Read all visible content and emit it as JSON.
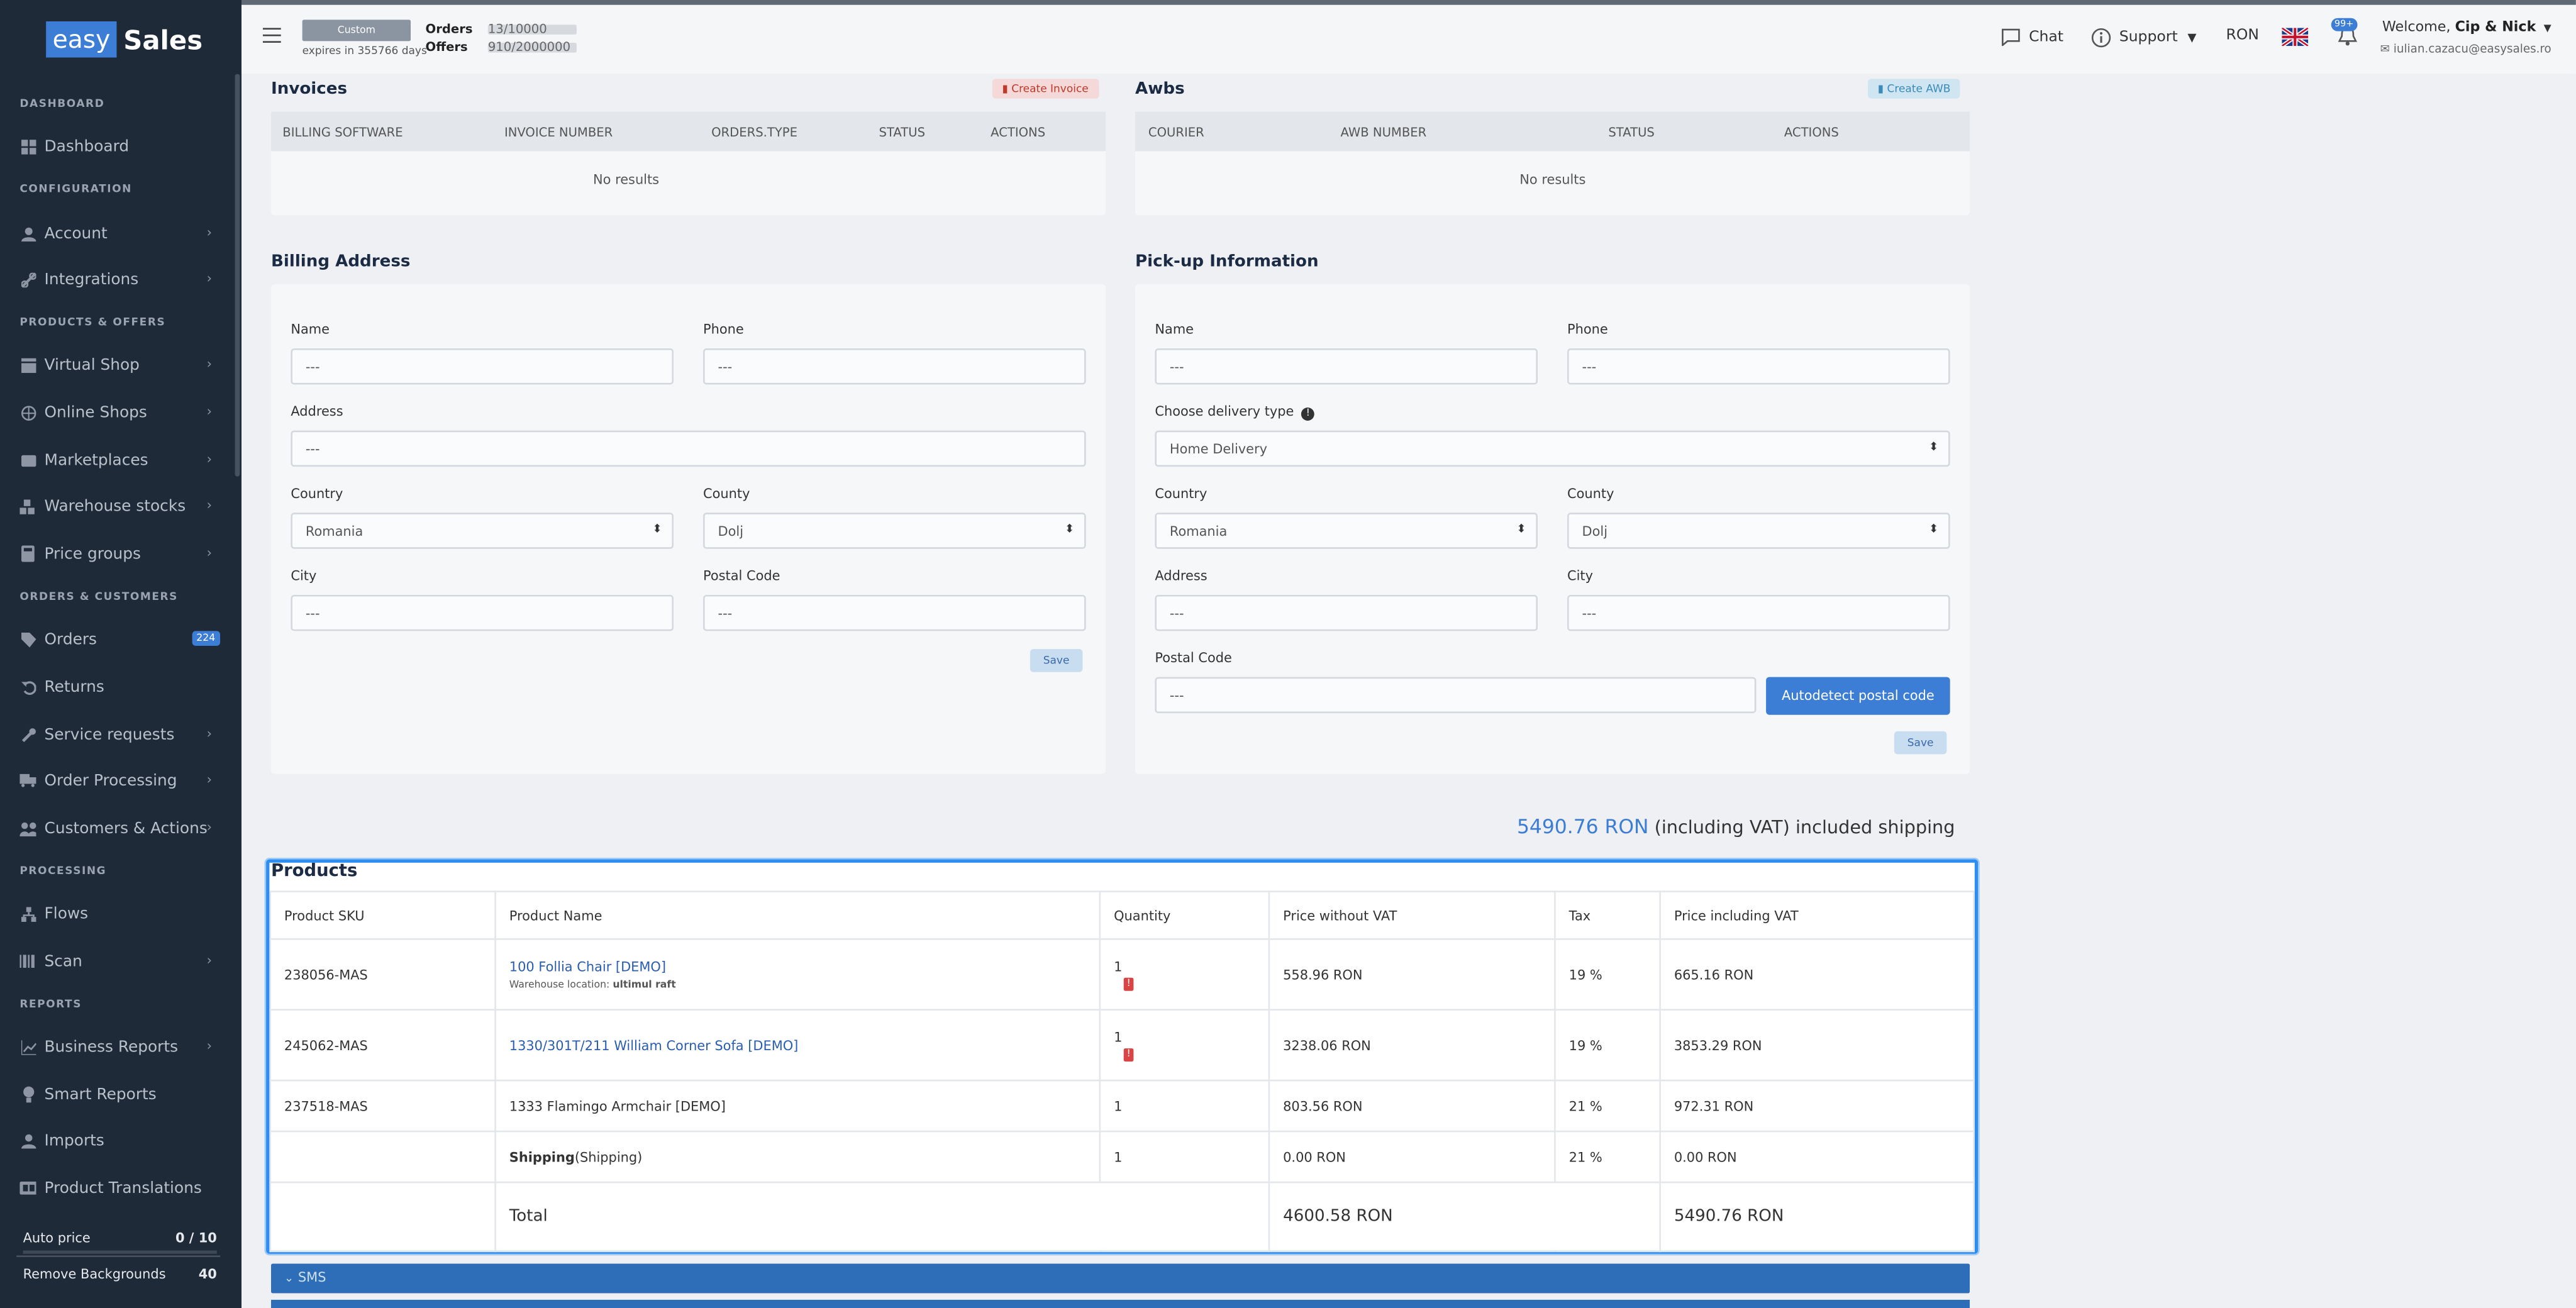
{
  "logo": {
    "left": "easy",
    "right": "Sales"
  },
  "sidebar": {
    "sections": {
      "dashboard": "DASHBOARD",
      "configuration": "CONFIGURATION",
      "products": "PRODUCTS & OFFERS",
      "orders": "ORDERS & CUSTOMERS",
      "processing": "PROCESSING",
      "reports": "REPORTS"
    },
    "items": [
      {
        "label": "Dashboard",
        "icon": "dashboard-icon"
      },
      {
        "label": "Account",
        "icon": "user-icon"
      },
      {
        "label": "Integrations",
        "icon": "link-icon"
      },
      {
        "label": "Virtual Shop",
        "icon": "store-icon"
      },
      {
        "label": "Online Shops",
        "icon": "globe-icon"
      },
      {
        "label": "Marketplaces",
        "icon": "marketplace-icon"
      },
      {
        "label": "Warehouse stocks",
        "icon": "boxes-icon"
      },
      {
        "label": "Price groups",
        "icon": "calculator-icon"
      },
      {
        "label": "Orders",
        "icon": "tag-icon",
        "badge": "224"
      },
      {
        "label": "Returns",
        "icon": "undo-icon"
      },
      {
        "label": "Service requests",
        "icon": "wrench-icon"
      },
      {
        "label": "Order Processing",
        "icon": "truck-icon"
      },
      {
        "label": "Customers & Actions",
        "icon": "users-icon"
      },
      {
        "label": "Flows",
        "icon": "flows-icon"
      },
      {
        "label": "Scan",
        "icon": "barcode-icon"
      },
      {
        "label": "Business Reports",
        "icon": "chart-icon"
      },
      {
        "label": "Smart Reports",
        "icon": "bulb-icon"
      },
      {
        "label": "Imports",
        "icon": "import-icon"
      },
      {
        "label": "Product Translations",
        "icon": "translate-icon"
      }
    ],
    "credits": [
      {
        "label": "Auto price",
        "value": "0 / 10"
      },
      {
        "label": "Remove Backgrounds",
        "value": "40"
      }
    ]
  },
  "header": {
    "plan": "Custom",
    "expires": "expires in 355766 days",
    "orders_label": "Orders",
    "orders_value": "13/10000",
    "offers_label": "Offers",
    "offers_value": "910/2000000",
    "chat": "Chat",
    "support": "Support",
    "currency": "RON",
    "notifications": "99+",
    "welcome_prefix": "Welcome, ",
    "welcome_name": "Cip & Nick",
    "email": "iulian.cazacu@easysales.ro"
  },
  "invoices": {
    "title": "Invoices",
    "create": "Create Invoice",
    "columns": [
      "BILLING SOFTWARE",
      "INVOICE NUMBER",
      "ORDERS.TYPE",
      "STATUS",
      "ACTIONS"
    ],
    "empty": "No results"
  },
  "awbs": {
    "title": "Awbs",
    "create": "Create AWB",
    "columns": [
      "COURIER",
      "AWB NUMBER",
      "STATUS",
      "ACTIONS"
    ],
    "empty": "No results"
  },
  "billing": {
    "title": "Billing Address",
    "name_label": "Name",
    "name_value": "---",
    "phone_label": "Phone",
    "phone_value": "---",
    "address_label": "Address",
    "address_value": "---",
    "country_label": "Country",
    "country_value": "Romania",
    "county_label": "County",
    "county_value": "Dolj",
    "city_label": "City",
    "city_value": "---",
    "postal_label": "Postal Code",
    "postal_value": "---",
    "save": "Save"
  },
  "pickup": {
    "title": "Pick-up Information",
    "name_label": "Name",
    "name_value": "---",
    "phone_label": "Phone",
    "phone_value": "---",
    "delivery_label": "Choose delivery type",
    "delivery_value": "Home Delivery",
    "country_label": "Country",
    "country_value": "Romania",
    "county_label": "County",
    "county_value": "Dolj",
    "address_label": "Address",
    "address_value": "---",
    "city_label": "City",
    "city_value": "---",
    "postal_label": "Postal Code",
    "postal_value": "---",
    "autodetect": "Autodetect postal code",
    "save": "Save"
  },
  "order_total": {
    "amount": "5490.76 RON",
    "suffix": "(including VAT) included shipping"
  },
  "products": {
    "title": "Products",
    "columns": [
      "Product SKU",
      "Product Name",
      "Quantity",
      "Price without VAT",
      "Tax",
      "Price including VAT"
    ],
    "rows": [
      {
        "sku": "238056-MAS",
        "name": "100 Follia Chair [DEMO]",
        "location_label": "Warehouse location: ",
        "location": "ultimul raft",
        "qty": "1",
        "price": "558.96 RON",
        "tax": "19 %",
        "price_vat": "665.16 RON"
      },
      {
        "sku": "245062-MAS",
        "name": "1330/301T/211 William Corner Sofa [DEMO]",
        "qty": "1",
        "price": "3238.06 RON",
        "tax": "19 %",
        "price_vat": "3853.29 RON"
      },
      {
        "sku": "237518-MAS",
        "name": "1333 Flamingo Armchair [DEMO]",
        "qty": "1",
        "price": "803.56 RON",
        "tax": "21 %",
        "price_vat": "972.31 RON"
      },
      {
        "sku": "",
        "name_bold": "Shipping",
        "name_rest": "(Shipping)",
        "qty": "1",
        "price": "0.00 RON",
        "tax": "21 %",
        "price_vat": "0.00 RON"
      }
    ],
    "total_label": "Total",
    "total_price": "4600.58 RON",
    "total_price_vat": "5490.76 RON"
  },
  "sms": {
    "label": "SMS"
  }
}
